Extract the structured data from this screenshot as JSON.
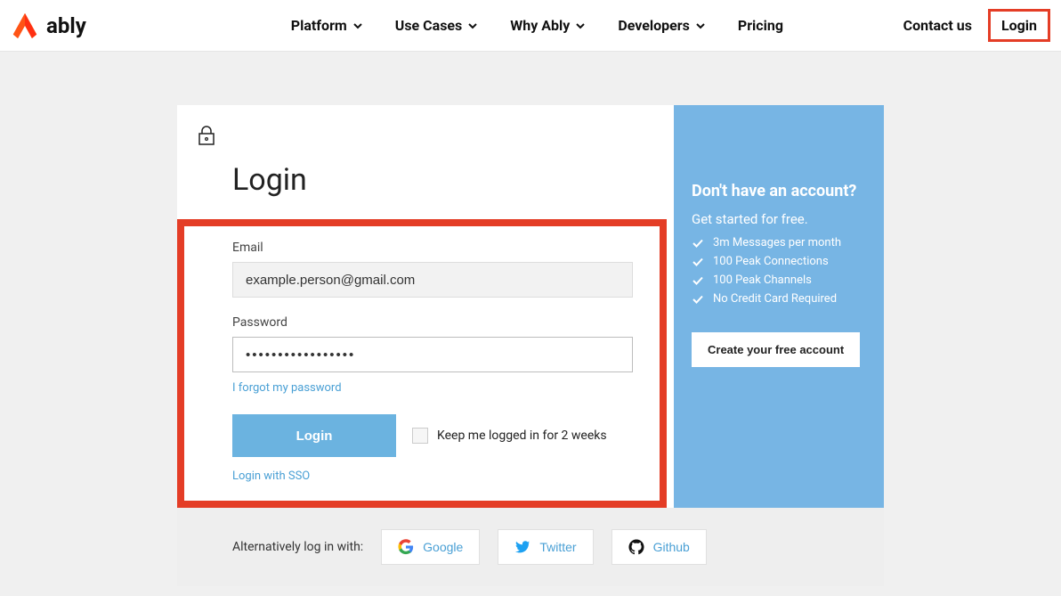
{
  "nav": {
    "brand": "ably",
    "items": [
      "Platform",
      "Use Cases",
      "Why Ably",
      "Developers",
      "Pricing"
    ],
    "contact": "Contact us",
    "login": "Login"
  },
  "login": {
    "title": "Login",
    "email_label": "Email",
    "email_value": "example.person@gmail.com",
    "password_label": "Password",
    "password_value": "•••••••••••••••••",
    "forgot": "I forgot my password",
    "button": "Login",
    "keep": "Keep me logged in for 2 weeks",
    "sso": "Login with SSO"
  },
  "promo": {
    "heading": "Don't have an account?",
    "sub": "Get started for free.",
    "bullets": [
      "3m Messages per month",
      "100 Peak Connections",
      "100 Peak Channels",
      "No Credit Card Required"
    ],
    "cta": "Create your free account"
  },
  "alt": {
    "label": "Alternatively log in with:",
    "google": "Google",
    "twitter": "Twitter",
    "github": "Github"
  }
}
